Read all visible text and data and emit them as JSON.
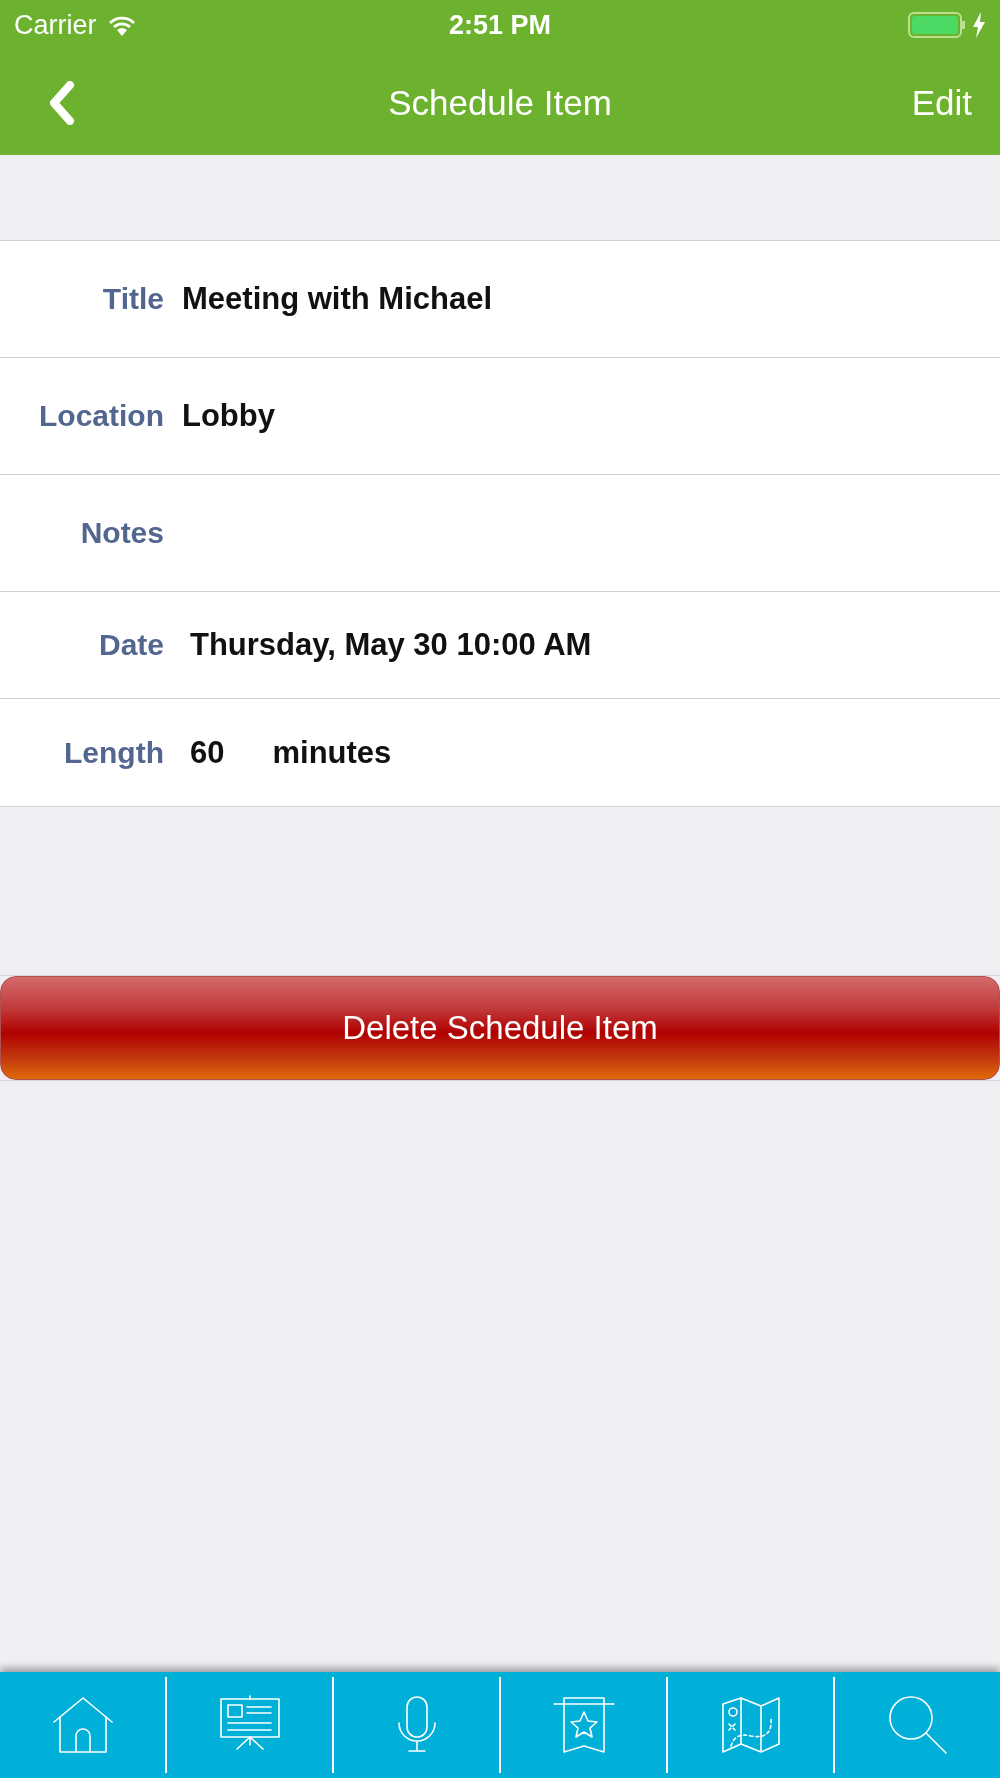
{
  "status_bar": {
    "carrier": "Carrier",
    "time": "2:51 PM"
  },
  "nav_bar": {
    "title": "Schedule Item",
    "action": "Edit"
  },
  "fields": [
    {
      "label": "Title",
      "value": "Meeting with Michael"
    },
    {
      "label": "Location",
      "value": "Lobby"
    },
    {
      "label": "Notes"
    },
    {
      "label": "Date",
      "value": "Thursday, May 30 10:00 AM"
    },
    {
      "label": "Length",
      "value": "60",
      "unit": "minutes"
    }
  ],
  "delete_button": "Delete Schedule Item",
  "tab_bar": {
    "items": [
      {
        "kind": "home"
      },
      {
        "kind": "presentation"
      },
      {
        "kind": "microphone"
      },
      {
        "kind": "bookmark"
      },
      {
        "kind": "map"
      },
      {
        "kind": "search"
      }
    ]
  }
}
